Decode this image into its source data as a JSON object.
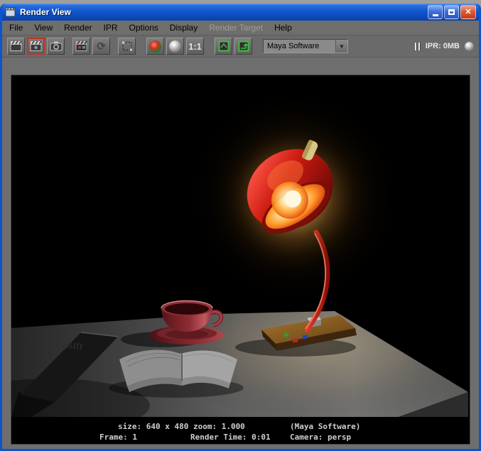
{
  "window": {
    "title": "Render View",
    "close_glyph": "✕"
  },
  "menu": {
    "items": [
      {
        "label": "File"
      },
      {
        "label": "View"
      },
      {
        "label": "Render"
      },
      {
        "label": "IPR"
      },
      {
        "label": "Options"
      },
      {
        "label": "Display"
      },
      {
        "label": "Render Target",
        "disabled": true
      },
      {
        "label": "Help"
      }
    ]
  },
  "toolbar": {
    "real_size_label": "1:1",
    "renderer_selected": "Maya Software",
    "dropdown_arrow": "▼",
    "ipr_memory": "IPR: 0MB"
  },
  "status": {
    "size_zoom": "size: 640 x 480 zoom: 1.000",
    "renderer": "(Maya Software)",
    "frame": "Frame: 1",
    "render_time": "Render Time: 0:01",
    "camera": "Camera: persp"
  },
  "scene": {
    "book_label": "maya2012",
    "objects": [
      "red desk lamp on wooden base",
      "red teacup with saucer",
      "open book",
      "dark book casting shadow",
      "gray desk"
    ]
  },
  "colors": {
    "titlebar_blue": "#1256cc",
    "ui_gray": "#6e6e6e",
    "lamp_red": "#cc1a10",
    "glow_yellow": "#ffc86a",
    "cup_red": "#8e2c34",
    "status_text": "#cfcfcf"
  }
}
